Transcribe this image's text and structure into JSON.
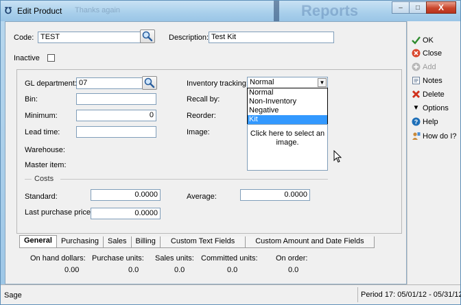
{
  "window": {
    "title": "Edit Product",
    "faded_title": "Thanks again",
    "background_title": "Reports",
    "controls": {
      "minimize": "‒",
      "maximize": "□",
      "close": "X"
    }
  },
  "form": {
    "code_label": "Code:",
    "code_value": "TEST",
    "description_label": "Description:",
    "description_value": "Test Kit",
    "inactive_label": "Inactive",
    "gl_department_label": "GL department:",
    "gl_department_value": "07",
    "inventory_tracking_label": "Inventory tracking:",
    "inventory_tracking_value": "Normal",
    "bin_label": "Bin:",
    "bin_value": "",
    "recall_by_label": "Recall by:",
    "minimum_label": "Minimum:",
    "minimum_value": "0",
    "reorder_label": "Reorder:",
    "lead_time_label": "Lead time:",
    "lead_time_value": "",
    "image_label": "Image:",
    "image_hint": "Click here to select an image.",
    "warehouse_label": "Warehouse:",
    "master_item_label": "Master item:",
    "costs_label": "Costs",
    "standard_label": "Standard:",
    "standard_value": "0.0000",
    "average_label": "Average:",
    "average_value": "0.0000",
    "last_purchase_price_label": "Last purchase price:",
    "last_purchase_price_value": "0.0000"
  },
  "tracking_options": [
    "Normal",
    "Non-Inventory",
    "Negative",
    "Kit"
  ],
  "tracking_selected_index": 3,
  "tabs": [
    "General",
    "Purchasing",
    "Sales",
    "Billing",
    "Custom Text Fields",
    "Custom Amount and Date Fields"
  ],
  "stats": {
    "headers": [
      "On hand dollars:",
      "Purchase units:",
      "Sales units:",
      "Committed units:",
      "On order:"
    ],
    "values": [
      "0.00",
      "0.0",
      "0.0",
      "0.0",
      "0.0"
    ]
  },
  "sidebar": {
    "ok": "OK",
    "close": "Close",
    "add": "Add",
    "notes": "Notes",
    "delete": "Delete",
    "options": "Options",
    "help": "Help",
    "how_do_i": "How do I?"
  },
  "status": {
    "left": "Sage",
    "period": "Period 17: 05/01/12 - 05/31/12"
  }
}
